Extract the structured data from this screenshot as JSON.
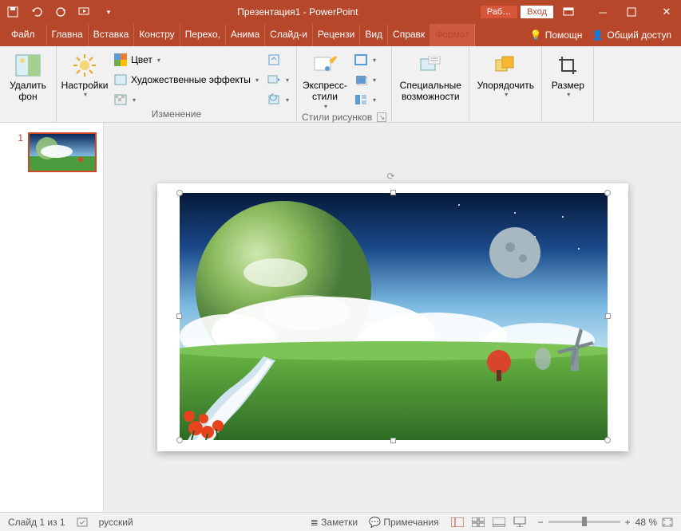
{
  "title": "Презентация1 - PowerPoint",
  "account": {
    "workLabel": "Раб…",
    "signIn": "Вход"
  },
  "tabs": {
    "file": "Файл",
    "items": [
      "Главна",
      "Вставка",
      "Констру",
      "Перехо,",
      "Анима",
      "Слайд-и",
      "Рецензи",
      "Вид",
      "Справк"
    ],
    "context": "Формат",
    "tell": "Помощн",
    "share": "Общий доступ"
  },
  "ribbon": {
    "removeBg": "Удалить\nфон",
    "adjust": {
      "corrections": "Настройки",
      "color": "Цвет",
      "effects": "Художественные эффекты",
      "groupLabel": "Изменение"
    },
    "styles": {
      "quick": "Экспресс-\nстили",
      "groupLabel": "Стили рисунков"
    },
    "access": "Специальные\nвозможности",
    "arrange": "Упорядочить",
    "size": "Размер"
  },
  "thumbnails": {
    "num1": "1"
  },
  "status": {
    "slide": "Слайд 1 из 1",
    "lang": "русский",
    "notes": "Заметки",
    "comments": "Примечания",
    "zoom": "48 %"
  }
}
